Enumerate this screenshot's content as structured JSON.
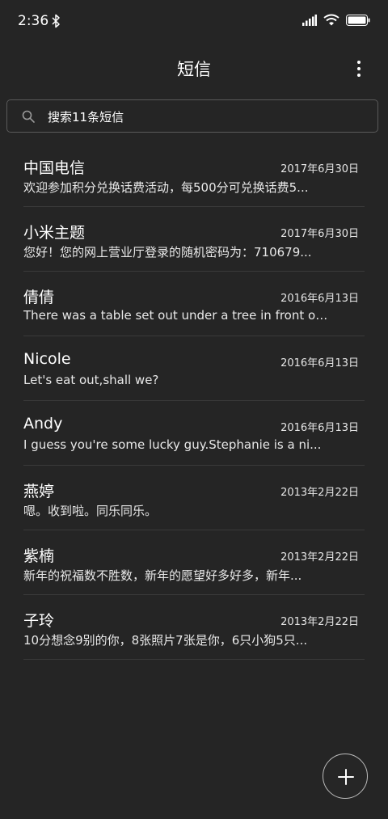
{
  "status_bar": {
    "time": "2:36",
    "icons": [
      "bluetooth-icon",
      "signal-icon",
      "wifi-icon",
      "battery-icon"
    ]
  },
  "header": {
    "title": "短信",
    "menu_icon": "more-vertical-icon"
  },
  "search": {
    "icon": "search-icon",
    "placeholder": "搜索11条短信"
  },
  "conversations": [
    {
      "name": "中国电信",
      "date": "2017年6月30日",
      "preview": "欢迎参加积分兑换话费活动，每500分可兑换话费5..."
    },
    {
      "name": "小米主题",
      "date": "2017年6月30日",
      "preview": "您好！您的网上营业厅登录的随机密码为：710679..."
    },
    {
      "name": "倩倩",
      "date": "2016年6月13日",
      "preview": "There was a table set out under a tree in front of ..."
    },
    {
      "name": "Nicole",
      "date": "2016年6月13日",
      "preview": "Let's eat out,shall we?"
    },
    {
      "name": "Andy",
      "date": "2016年6月13日",
      "preview": "I guess you're some lucky guy.Stephanie is a ni..."
    },
    {
      "name": "燕婷",
      "date": "2013年2月22日",
      "preview": "嗯。收到啦。同乐同乐。"
    },
    {
      "name": "紫楠",
      "date": "2013年2月22日",
      "preview": "新年的祝福数不胜数，新年的愿望好多好多，新年..."
    },
    {
      "name": "子玲",
      "date": "2013年2月22日",
      "preview": "10分想念9别的你，8张照片7张是你，6只小狗5只..."
    }
  ],
  "fab": {
    "icon": "plus-icon"
  },
  "colors": {
    "background": "#252525",
    "text": "#ffffff",
    "divider": "#3a3a3a",
    "border": "#5a5a5a"
  }
}
